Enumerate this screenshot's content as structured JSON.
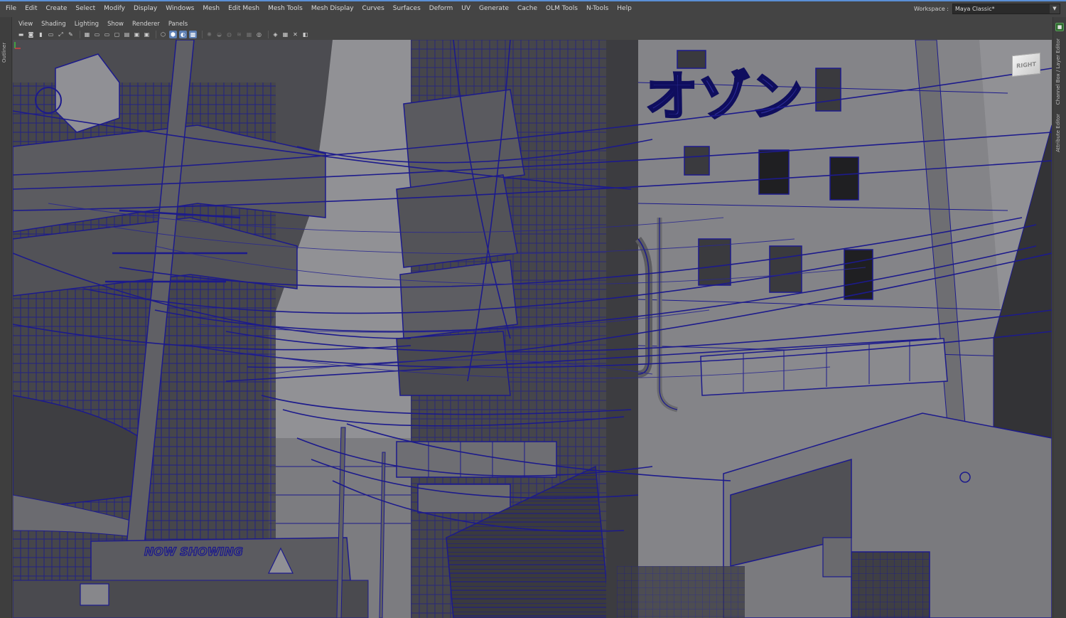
{
  "menubar": {
    "items": [
      "File",
      "Edit",
      "Create",
      "Select",
      "Modify",
      "Display",
      "Windows",
      "Mesh",
      "Edit Mesh",
      "Mesh Tools",
      "Mesh Display",
      "Curves",
      "Surfaces",
      "Deform",
      "UV",
      "Generate",
      "Cache",
      "OLM Tools",
      "N-Tools",
      "Help"
    ]
  },
  "workspace": {
    "label": "Workspace :",
    "value": "Maya Classic*"
  },
  "left_panel": {
    "tab": "Outliner"
  },
  "right_panel": {
    "tabs": [
      "Channel Box / Layer Editor",
      "Attribute Editor"
    ]
  },
  "viewport": {
    "menus": [
      "View",
      "Shading",
      "Lighting",
      "Show",
      "Renderer",
      "Panels"
    ],
    "viewcube_label": "RIGHT",
    "toolbar_icons": [
      "camera-icon",
      "camera-attributes-icon",
      "bookmark-icon",
      "image-plane-icon",
      "2d-pan-zoom-icon",
      "grease-pencil-icon",
      "grid-icon",
      "film-gate-icon",
      "resolution-gate-icon",
      "gate-mask-icon",
      "field-chart-icon",
      "safe-action-icon",
      "safe-title-icon",
      "wireframe-icon",
      "smooth-shade-icon",
      "wireframe-on-shaded-icon",
      "textured-icon",
      "use-all-lights-icon",
      "shadows-icon",
      "screen-space-ao-icon",
      "motion-blur-icon",
      "multisample-aa-icon",
      "depth-of-field-icon",
      "isolate-select-icon",
      "xray-icon",
      "xray-joints-icon",
      "backface-culling-icon"
    ],
    "accent_color": "#1c1a8c",
    "background_color": "#8f8f93"
  },
  "scene_text": {
    "neon_sign": "オゾン",
    "marquee": "NOW SHOWING"
  }
}
